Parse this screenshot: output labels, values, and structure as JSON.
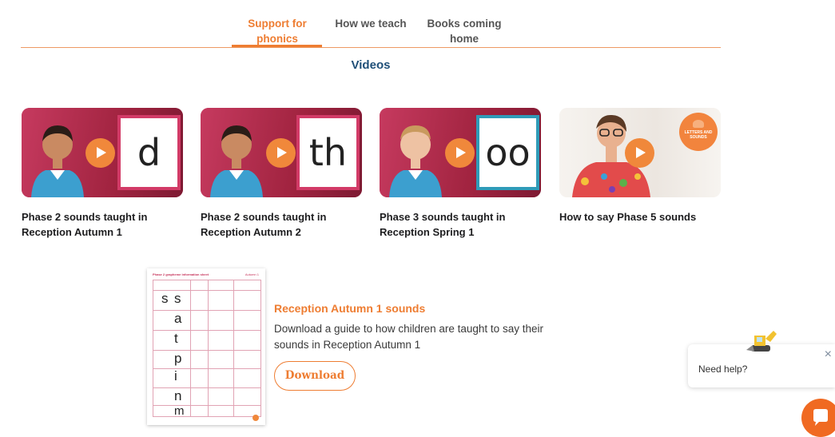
{
  "tabs": [
    {
      "label_line1": "Support for",
      "label_line2": "phonics",
      "active": true
    },
    {
      "label_line1": "How we teach",
      "label_line2": "",
      "active": false
    },
    {
      "label_line1": "Books coming",
      "label_line2": "home",
      "active": false
    }
  ],
  "section_title": "Videos",
  "videos": [
    {
      "title": "Phase 2 sounds taught in Reception Autumn 1",
      "card_text": "d"
    },
    {
      "title": "Phase 2 sounds taught in Reception Autumn 2",
      "card_text": "th"
    },
    {
      "title": "Phase 3 sounds taught in Reception Spring 1",
      "card_text": "oo"
    },
    {
      "title": "How to say Phase 5 sounds"
    }
  ],
  "download_promo": {
    "title": "Reception Autumn 1 sounds",
    "description": "Download a guide to how children are taught to say their sounds in Reception Autumn 1",
    "button_label": "Download",
    "thumbnail_letters": [
      "s",
      "a",
      "t",
      "p",
      "i",
      "n",
      "m"
    ]
  },
  "help_widget": {
    "text": "Need help?",
    "close_symbol": "×"
  },
  "colors": {
    "accent": "#ee7d32",
    "heading_blue": "#1f4f78",
    "thumb_red": "#b22d52"
  }
}
